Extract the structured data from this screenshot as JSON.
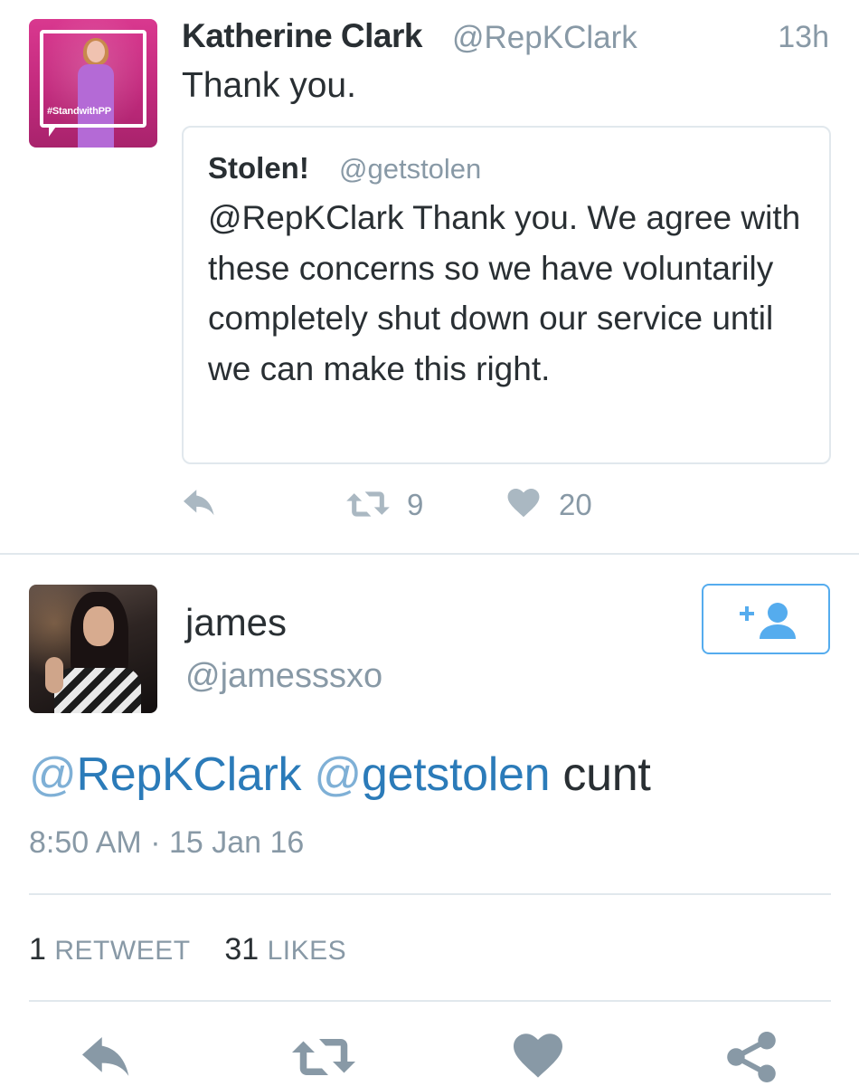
{
  "tweet1": {
    "author_name": "Katherine Clark",
    "author_handle": "@RepKClark",
    "time": "13h",
    "text": "Thank you.",
    "avatar_tag": "#StandwithPP",
    "quote": {
      "author_name": "Stolen!",
      "author_handle": "@getstolen",
      "text": "@RepKClark Thank you. We agree with these concerns so we have voluntarily completely shut down our service until we can make this right."
    },
    "actions": {
      "retweet_count": "9",
      "like_count": "20"
    }
  },
  "tweet2": {
    "author_name": "james",
    "author_handle": "@jamesssxo",
    "mention1": "RepKClark",
    "mention2": "getstolen",
    "body": "cunt",
    "timestamp": "8:50 AM · 15 Jan 16",
    "stats": {
      "retweets": "1",
      "retweets_label": "RETWEET",
      "likes": "31",
      "likes_label": "LIKES"
    }
  },
  "colors": {
    "link": "#2b7bb9",
    "muted": "#8899a6",
    "text": "#292f33",
    "border": "#e1e8ed",
    "follow": "#55acee"
  },
  "icons": [
    "reply-icon",
    "retweet-icon",
    "like-icon",
    "share-icon",
    "follow-user-icon"
  ]
}
